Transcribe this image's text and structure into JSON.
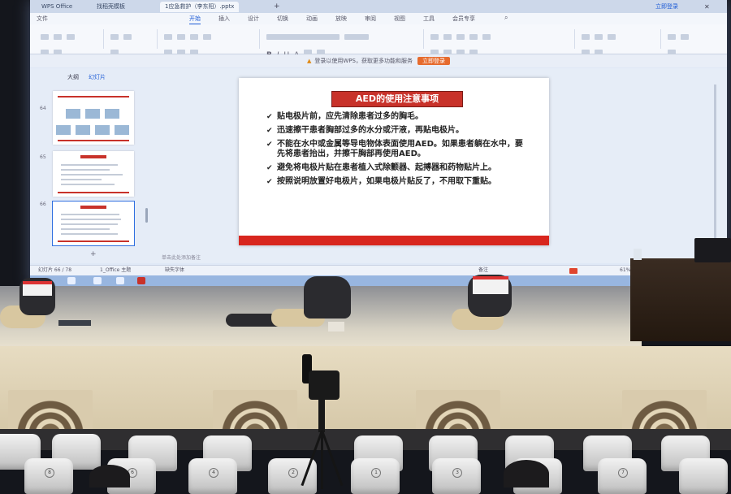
{
  "screen": {
    "tabs": [
      "WPS Office",
      "找稻壳模板",
      "1应急救护（李东阳）.pptx"
    ],
    "active_tab_index": 2,
    "menu": [
      "文件",
      "开始",
      "插入",
      "设计",
      "切换",
      "动画",
      "放映",
      "审阅",
      "视图",
      "工具",
      "会员专享"
    ],
    "active_menu": "开始",
    "account": "立即登录",
    "notice": {
      "text": "登录以使用WPS，获取更多功能和服务",
      "button": "立即登录"
    },
    "panel_tabs": [
      "大纲",
      "幻灯片"
    ],
    "thumb_numbers": [
      "64",
      "65",
      "66"
    ],
    "notes_placeholder": "单击此处添加备注",
    "status": {
      "slide": "幻灯片 66 / 78",
      "theme": "1_Office 主题",
      "font_missing": "缺失字体",
      "notes_btn": "备注",
      "zoom": "61%"
    }
  },
  "slide": {
    "title": "AED的使用注意事项",
    "bullets": [
      "贴电极片前，应先清除患者过多的胸毛。",
      "迅速擦干患者胸部过多的水分或汗液，再贴电极片。",
      "不能在水中或金属等导电物体表面使用AED。如果患者躺在水中，要先将患者抬出，并擦干胸部再使用AED。",
      "避免将电极片贴在患者植入式除颤器、起搏器和药物贴片上。",
      "按照说明放置好电极片，如果电极片贴反了，不用取下重贴。"
    ],
    "colors": {
      "title_bg": "#c8322a",
      "footer_bar": "#d8261e"
    }
  },
  "seats": {
    "numbers": [
      "8",
      "6",
      "4",
      "2",
      "1",
      "3",
      "5",
      "7"
    ]
  }
}
